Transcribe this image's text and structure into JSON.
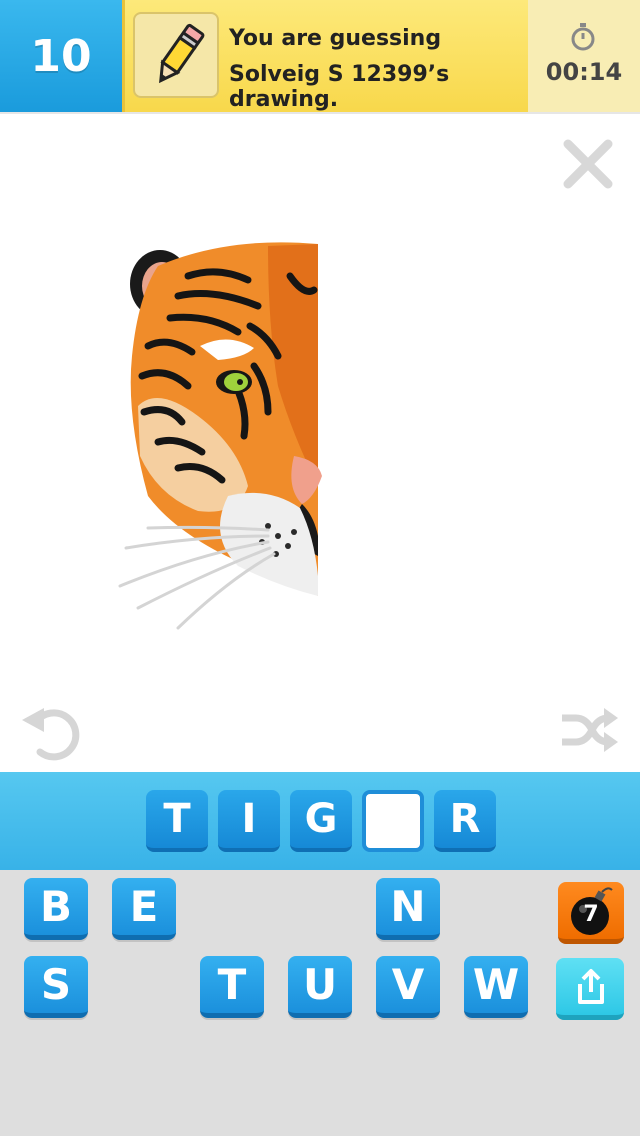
{
  "header": {
    "score": "10",
    "banner_line1": "You are guessing",
    "banner_line2": "Solveig S 12399’s drawing.",
    "timer": "00:14",
    "icons": {
      "pencil": "pencil-icon",
      "timer": "stopwatch-icon"
    }
  },
  "canvas": {
    "icons": {
      "close": "close-icon",
      "undo": "undo-icon",
      "shuffle": "shuffle-icon"
    }
  },
  "answer": {
    "slots": [
      "T",
      "I",
      "G",
      "",
      "R"
    ]
  },
  "keyboard": {
    "row1": [
      "B",
      "E",
      "N"
    ],
    "row2": [
      "S",
      "T",
      "U",
      "V",
      "W"
    ],
    "bomb_count": "7",
    "icons": {
      "bomb": "bomb-icon",
      "share": "share-icon"
    }
  },
  "colors": {
    "score_blue": "#1a9bdc",
    "banner_yellow": "#f8d84b",
    "answer_bar": "#38b2e8",
    "key_blue": "#1b90dc",
    "bomb_orange": "#ef6d00",
    "share_cyan": "#2ec8e6",
    "keyboard_bg": "#dedede"
  }
}
